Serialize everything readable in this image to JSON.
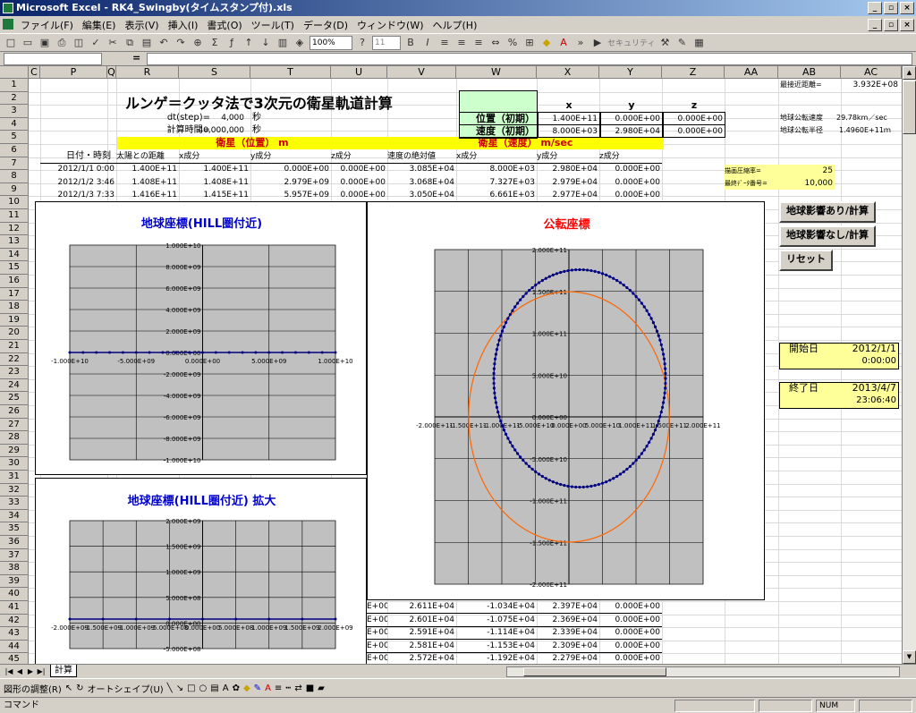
{
  "window": {
    "title": "Microsoft Excel - RK4_Swingby(タイムスタンプ付).xls"
  },
  "menu": [
    "ファイル(F)",
    "編集(E)",
    "表示(V)",
    "挿入(I)",
    "書式(O)",
    "ツール(T)",
    "データ(D)",
    "ウィンドウ(W)",
    "ヘルプ(H)"
  ],
  "toolbar": {
    "zoom": "100%",
    "font_size": "11",
    "security": "セキュリティ"
  },
  "formula": {
    "equals": "="
  },
  "columns": [
    "C",
    "P",
    "Q",
    "R",
    "S",
    "T",
    "U",
    "V",
    "W",
    "X",
    "Y",
    "Z",
    "AA",
    "AB",
    "AC"
  ],
  "rows": [
    "1",
    "2",
    "3",
    "4",
    "5",
    "6",
    "7",
    "8",
    "9",
    "10",
    "11",
    "12",
    "13",
    "14",
    "15",
    "16",
    "17",
    "18",
    "19",
    "20",
    "21",
    "22",
    "23",
    "24",
    "25",
    "26",
    "27",
    "28",
    "29",
    "30",
    "31",
    "32",
    "33",
    "34",
    "35",
    "36",
    "37",
    "38",
    "39",
    "40",
    "41",
    "42",
    "43",
    "44",
    "45"
  ],
  "sheet": {
    "title": "ルンゲ＝クッタ法で3次元の衛星軌道計算",
    "dt_label": "dt(step)=",
    "dt_value": "4,000",
    "dt_unit": "秒",
    "calc_label": "計算時間=",
    "calc_value": "40,000,000",
    "calc_unit": "秒",
    "pos_header": "衛星（位置） m",
    "vel_header": "衛星（速度） m/sec",
    "init_table": {
      "headers": [
        "x",
        "y",
        "z"
      ],
      "rows": [
        {
          "label": "位置（初期）",
          "values": [
            "1.400E+11",
            "0.000E+00",
            "0.000E+00"
          ]
        },
        {
          "label": "速度（初期）",
          "values": [
            "8.000E+03",
            "2.980E+04",
            "0.000E+00"
          ]
        }
      ]
    },
    "col_headers": [
      "日付・時刻",
      "太陽との距離",
      "x成分",
      "y成分",
      "z成分",
      "速度の絶対値",
      "x成分",
      "y成分",
      "z成分"
    ],
    "rows_top": [
      [
        "2012/1/1 0:00",
        "1.400E+11",
        "1.400E+11",
        "0.000E+00",
        "0.000E+00",
        "3.085E+04",
        "8.000E+03",
        "2.980E+04",
        "0.000E+00"
      ],
      [
        "2012/1/2 3:46",
        "1.408E+11",
        "1.408E+11",
        "2.979E+09",
        "0.000E+00",
        "3.068E+04",
        "7.327E+03",
        "2.979E+04",
        "0.000E+00"
      ],
      [
        "2012/1/3 7:33",
        "1.416E+11",
        "1.415E+11",
        "5.957E+09",
        "0.000E+00",
        "3.050E+04",
        "6.661E+03",
        "2.977E+04",
        "0.000E+00"
      ]
    ],
    "rows_bottom": [
      [
        "E+00",
        "2.611E+04",
        "-1.034E+04",
        "2.397E+04",
        "0.000E+00"
      ],
      [
        "E+00",
        "2.601E+04",
        "-1.075E+04",
        "2.369E+04",
        "0.000E+00"
      ],
      [
        "E+00",
        "2.591E+04",
        "-1.114E+04",
        "2.339E+04",
        "0.000E+00"
      ],
      [
        "E+00",
        "2.581E+04",
        "-1.153E+04",
        "2.309E+04",
        "0.000E+00"
      ],
      [
        "E+00",
        "2.572E+04",
        "-1.192E+04",
        "2.279E+04",
        "0.000E+00"
      ]
    ],
    "right": {
      "closest_label": "最接近距離=",
      "closest_value": "3.932E+08",
      "earth_speed_label": "地球公転速度",
      "earth_speed_value": "29.78km／sec",
      "earth_radius_label": "地球公転半径",
      "earth_radius_value": "1.4960E+11ｍ",
      "interval_label": "描画圧縮率=",
      "interval_value": "25",
      "last_label": "最終ﾃﾞｰﾀ番号=",
      "last_value": "10,000",
      "start_label": "開始日",
      "start_date": "2012/1/1",
      "start_time": "0:00:00",
      "end_label": "終了日",
      "end_date": "2013/4/7",
      "end_time": "23:06:40"
    },
    "buttons": [
      "地球影響あり/計算",
      "地球影響なし/計算",
      "リセット"
    ]
  },
  "sheet_tab": "計算",
  "drawbar": {
    "adjust": "図形の調整(R)",
    "autoshape": "オートシェイプ(U)"
  },
  "status": {
    "text": "コマンド",
    "num": "NUM"
  },
  "chart_data": [
    {
      "type": "scatter",
      "title": "地球座標(HILL圏付近)",
      "xlim": [
        -10000000000.0,
        10000000000.0
      ],
      "ylim": [
        -10000000000.0,
        10000000000.0
      ],
      "x_ticks": [
        "-1.000E+10",
        "-5.000E+09",
        "0.000E+00",
        "5.000E+09",
        "1.000E+10"
      ],
      "y_ticks": [
        "1.000E+10",
        "8.000E+09",
        "6.000E+09",
        "4.000E+09",
        "2.000E+09",
        "0.000E+00",
        "-2.000E+09",
        "-4.000E+09",
        "-6.000E+09",
        "-8.000E+09",
        "-1.000E+10"
      ],
      "series": [
        {
          "x": [
            -10000000000.0,
            -9000000000.0,
            -8000000000.0,
            -7000000000.0,
            -6000000000.0,
            -5000000000.0,
            -4000000000.0,
            -3000000000.0,
            -2000000000.0,
            -1000000000.0,
            0,
            1000000000.0,
            2000000000.0,
            3000000000.0,
            4000000000.0,
            5000000000.0,
            6000000000.0,
            7000000000.0,
            8000000000.0,
            9000000000.0,
            10000000000.0
          ],
          "y": [
            0,
            0,
            0,
            0,
            0,
            0,
            0,
            0,
            0,
            0,
            0,
            0,
            0,
            0,
            0,
            0,
            0,
            0,
            0,
            0,
            0
          ]
        }
      ],
      "grid": true
    },
    {
      "type": "scatter",
      "title": "地球座標(HILL圏付近) 拡大",
      "xlim": [
        -2000000000.0,
        2000000000.0
      ],
      "ylim": [
        -600000000.0,
        2000000000.0
      ],
      "x_ticks": [
        "-2.000E+09",
        "-1.500E+09",
        "-1.000E+09",
        "-5.000E+08",
        "0.000E+00",
        "5.000E+08",
        "1.000E+09",
        "1.500E+09",
        "2.000E+09"
      ],
      "y_ticks": [
        "2.000E+09",
        "1.500E+09",
        "1.000E+09",
        "5.000E+08",
        "0.000E+00",
        "-5.000E+08"
      ],
      "series": [
        {
          "x": [
            -2000000000.0,
            -1500000000.0,
            -1000000000.0,
            -500000000.0,
            0,
            500000000.0,
            1000000000.0,
            1500000000.0,
            2000000000.0
          ],
          "y": [
            0,
            0,
            0,
            0,
            0,
            0,
            0,
            0,
            0
          ]
        }
      ],
      "grid": true
    },
    {
      "type": "line",
      "title": "公転座標",
      "xlim": [
        -200000000000.0,
        200000000000.0
      ],
      "ylim": [
        -200000000000.0,
        200000000000.0
      ],
      "x_ticks": [
        "-2.000E+11",
        "-1.500E+11",
        "-1.000E+11",
        "-5.000E+10",
        "0.000E+00",
        "5.000E+10",
        "1.000E+11",
        "1.500E+11",
        "2.000E+11"
      ],
      "y_ticks": [
        "2.000E+11",
        "1.500E+11",
        "1.000E+11",
        "5.000E+10",
        "0.000E+00",
        "-5.000E+10",
        "-1.000E+11",
        "-1.500E+11",
        "-2.000E+11"
      ],
      "series": [
        {
          "color": "#000080",
          "shape": "ellipse",
          "cx": 16000000000.0,
          "cy": 46000000000.0,
          "rx": 128000000000.0,
          "ry": 130000000000.0
        },
        {
          "color": "#ff6600",
          "shape": "circle",
          "cx": 0,
          "cy": 0,
          "r": 149600000000.0
        }
      ],
      "grid": true
    }
  ]
}
